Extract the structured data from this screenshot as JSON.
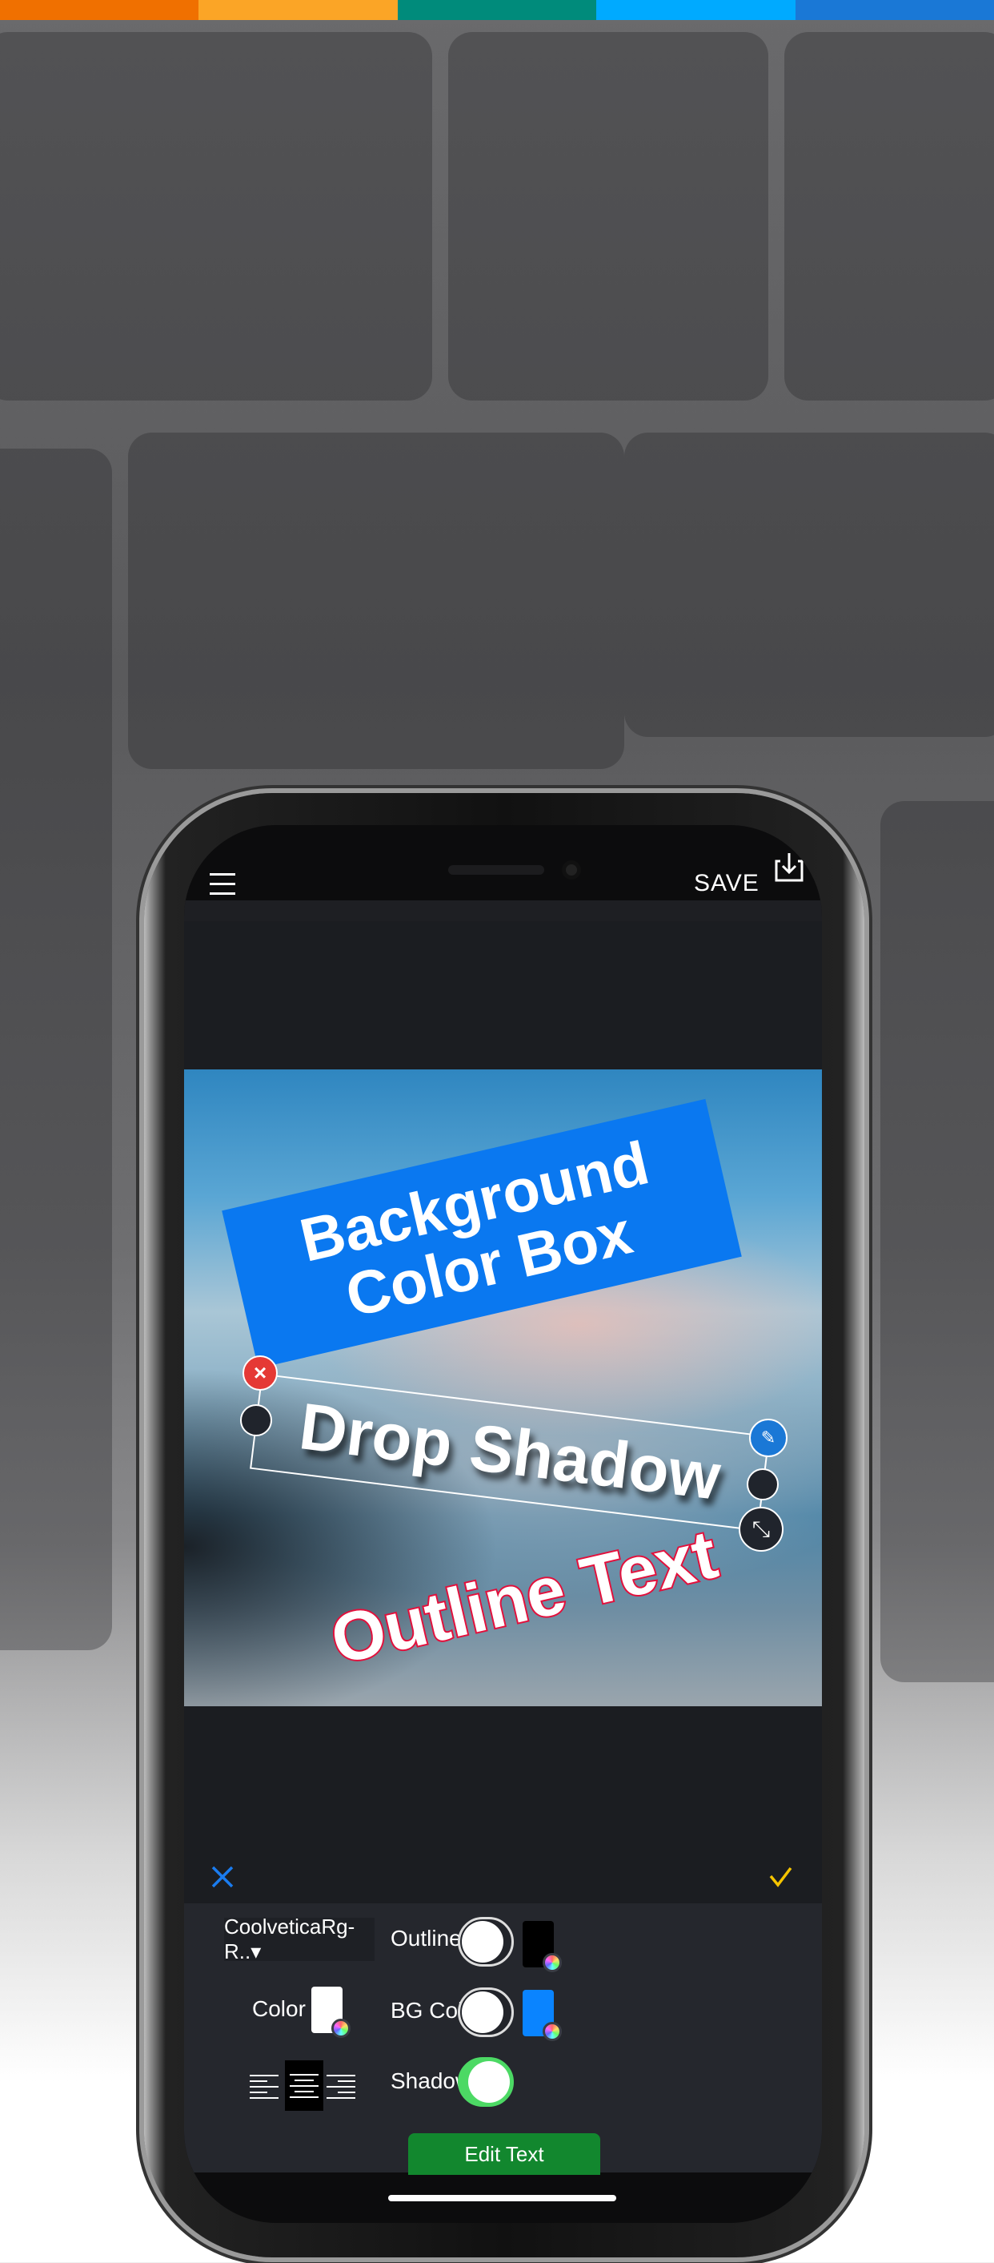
{
  "stripe_colors": [
    "#f07000",
    "#fba526",
    "#008b7b",
    "#00aaff",
    "#1a78d6"
  ],
  "header": {
    "menu_icon": "hamburger-icon",
    "save_label": "SAVE",
    "save_icon": "download-icon"
  },
  "canvas": {
    "bg_box_text": [
      "Background",
      "Color Box"
    ],
    "bg_box_color": "#0a78f0",
    "drop_shadow_text": "Drop Shadow",
    "outline_text": "Outline Text",
    "outline_color": "#e2103c",
    "handles": [
      "delete-icon",
      "edit-pencil-icon",
      "resize-icon"
    ]
  },
  "actions": {
    "cancel_icon": "close-icon",
    "confirm_icon": "checkmark-icon",
    "cancel_color": "#1a7cf0",
    "confirm_color": "#f5c400"
  },
  "panel": {
    "font_select": "CoolveticaRg-R..▾",
    "outline": {
      "label": "Outline",
      "enabled": false,
      "color": "#000000"
    },
    "color": {
      "label": "Color",
      "value": "#ffffff"
    },
    "bg_color": {
      "label": "BG Color",
      "enabled": false,
      "color": "#0a84ff"
    },
    "alignment": {
      "options": [
        "left",
        "center",
        "right"
      ],
      "selected": "center"
    },
    "shadow": {
      "label": "Shadow",
      "enabled": true
    },
    "edit_text_label": "Edit Text"
  }
}
